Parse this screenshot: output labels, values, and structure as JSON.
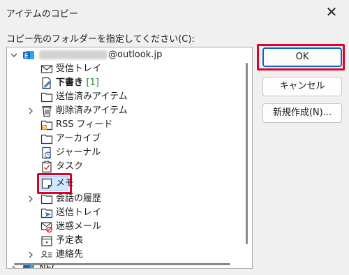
{
  "dialog": {
    "title": "アイテムのコピー",
    "close_glyph": "✕",
    "prompt": "コピー先のフォルダーを指定してください(C):"
  },
  "tree": {
    "account_suffix": "@outlook.jp",
    "items": [
      {
        "label": "受信トレイ",
        "icon": "inbox-icon"
      },
      {
        "label": "下書き",
        "count": "[1]",
        "icon": "drafts-icon"
      },
      {
        "label": "送信済みアイテム",
        "icon": "sent-items-icon"
      },
      {
        "label": "削除済みアイテム",
        "icon": "trash-icon"
      },
      {
        "label": "RSS フィード",
        "icon": "rss-icon"
      },
      {
        "label": "アーカイブ",
        "icon": "archive-icon"
      },
      {
        "label": "ジャーナル",
        "icon": "journal-icon"
      },
      {
        "label": "タスク",
        "icon": "tasks-icon"
      },
      {
        "label": "メモ",
        "icon": "notes-icon"
      },
      {
        "label": "会話の履歴",
        "icon": "conversation-history-icon"
      },
      {
        "label": "送信トレイ",
        "icon": "outbox-icon"
      },
      {
        "label": "迷惑メール",
        "icon": "junk-email-icon"
      },
      {
        "label": "予定表",
        "icon": "calendar-icon"
      },
      {
        "label": "連絡先",
        "icon": "contacts-icon"
      }
    ],
    "second_account_partial": "NEC"
  },
  "buttons": {
    "ok": "OK",
    "cancel": "キャンセル",
    "new_folder": "新規作成(N)..."
  },
  "colors": {
    "highlight_outline": "#e0002a",
    "selection_fill": "#cde8ff",
    "primary_border": "#0a64c8",
    "outlook_blue": "#0f6cbd"
  }
}
